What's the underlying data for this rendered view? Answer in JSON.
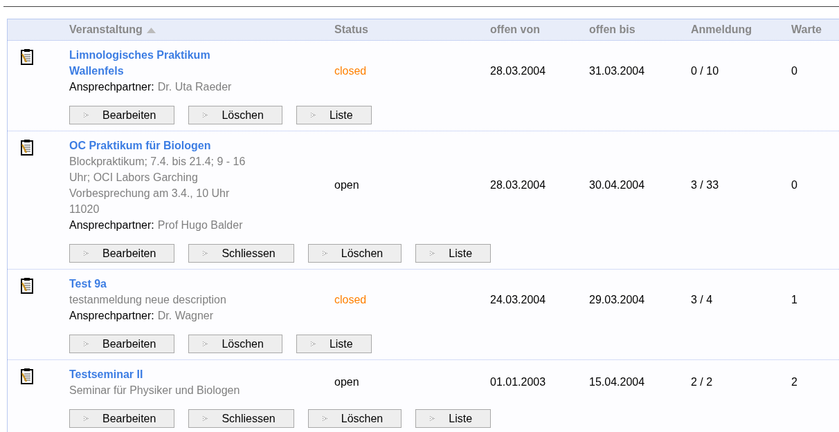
{
  "table": {
    "columns": [
      {
        "label": "Veranstaltung",
        "sorted": true
      },
      {
        "label": "Status",
        "sorted": false
      },
      {
        "label": "offen von",
        "sorted": false
      },
      {
        "label": "offen bis",
        "sorted": false
      },
      {
        "label": "Anmeldung",
        "sorted": false
      },
      {
        "label": "Warte",
        "sorted": false
      }
    ],
    "rows": [
      {
        "title_lines": [
          "Limnologisches Praktikum",
          "Wallenfels"
        ],
        "description_lines": [],
        "contact_label": "Ansprechpartner:",
        "contact": "Dr. Uta Raeder",
        "status": "closed",
        "closed": true,
        "open_from": "28.03.2004",
        "open_until": "31.03.2004",
        "registrations": "0 / 10",
        "waiting": "0",
        "buttons": [
          "Bearbeiten",
          "Löschen",
          "Liste"
        ]
      },
      {
        "title_lines": [
          "OC Praktikum für Biologen"
        ],
        "description_lines": [
          "Blockpraktikum; 7.4. bis 21.4; 9 - 16",
          "Uhr; OCI Labors Garching",
          "Vorbesprechung am 3.4., 10 Uhr",
          "11020"
        ],
        "contact_label": "Ansprechpartner:",
        "contact": "Prof Hugo Balder",
        "status": "open",
        "closed": false,
        "open_from": "28.03.2004",
        "open_until": "30.04.2004",
        "registrations": "3 / 33",
        "waiting": "0",
        "buttons": [
          "Bearbeiten",
          "Schliessen",
          "Löschen",
          "Liste"
        ]
      },
      {
        "title_lines": [
          "Test 9a"
        ],
        "description_lines": [
          "testanmeldung neue description"
        ],
        "contact_label": "Ansprechpartner:",
        "contact": "Dr. Wagner",
        "status": "closed",
        "closed": true,
        "open_from": "24.03.2004",
        "open_until": "29.03.2004",
        "registrations": "3 / 4",
        "waiting": "1",
        "buttons": [
          "Bearbeiten",
          "Löschen",
          "Liste"
        ]
      },
      {
        "title_lines": [
          "Testseminar II"
        ],
        "description_lines": [
          "Seminar für Physiker und Biologen"
        ],
        "status": "open",
        "closed": false,
        "open_from": "01.01.2003",
        "open_until": "15.04.2004",
        "registrations": "2 / 2",
        "waiting": "2",
        "buttons": [
          "Bearbeiten",
          "Schliessen",
          "Löschen",
          "Liste"
        ]
      }
    ]
  }
}
